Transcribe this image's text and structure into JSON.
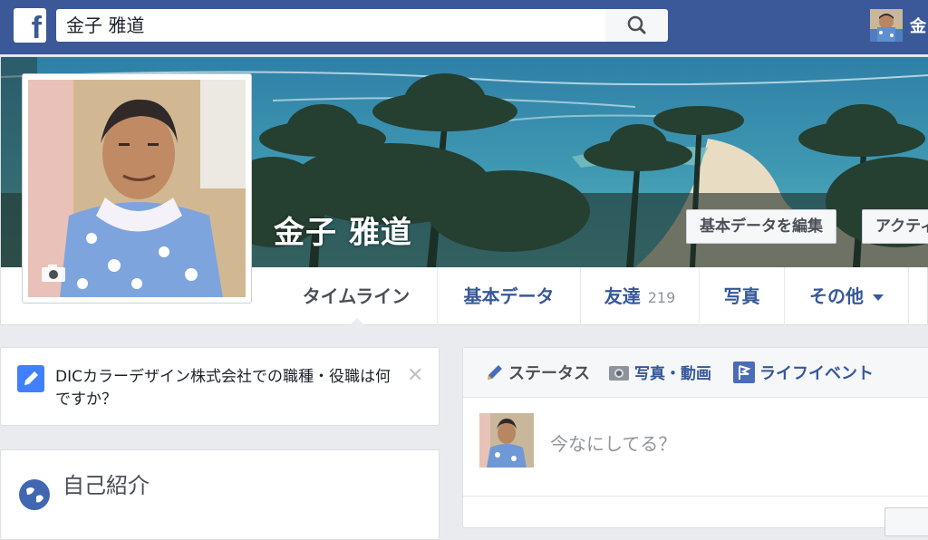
{
  "app": {
    "name": "Facebook",
    "logo_glyph": "f",
    "brand_color": "#3b5998"
  },
  "topbar": {
    "search_value": "金子 雅道",
    "search_icon": "search-icon",
    "user_name_truncated": "金"
  },
  "profile": {
    "name": "金子 雅道",
    "camera_icon": "camera-icon"
  },
  "cover": {
    "camera_icon": "camera-icon",
    "edit_button": "基本データを編集",
    "activity_button": "アクティ"
  },
  "nav": {
    "tabs": [
      {
        "label": "タイムライン"
      },
      {
        "label": "基本データ"
      },
      {
        "label": "友達",
        "count": "219"
      },
      {
        "label": "写真"
      },
      {
        "label": "その他"
      }
    ]
  },
  "job_prompt": {
    "text": "DICカラーデザイン株式会社での職種・役職は何ですか？",
    "close": "✕"
  },
  "intro": {
    "title": "自己紹介"
  },
  "composer": {
    "tabs": [
      {
        "label": "ステータス",
        "icon": "pencil-icon"
      },
      {
        "label": "写真・動画",
        "icon": "photo-icon"
      },
      {
        "label": "ライフイベント",
        "icon": "flag-icon"
      }
    ],
    "placeholder": "今なにしてる？"
  },
  "colors": {
    "link": "#365899",
    "accent": "#4080ff",
    "muted": "#90949c"
  }
}
